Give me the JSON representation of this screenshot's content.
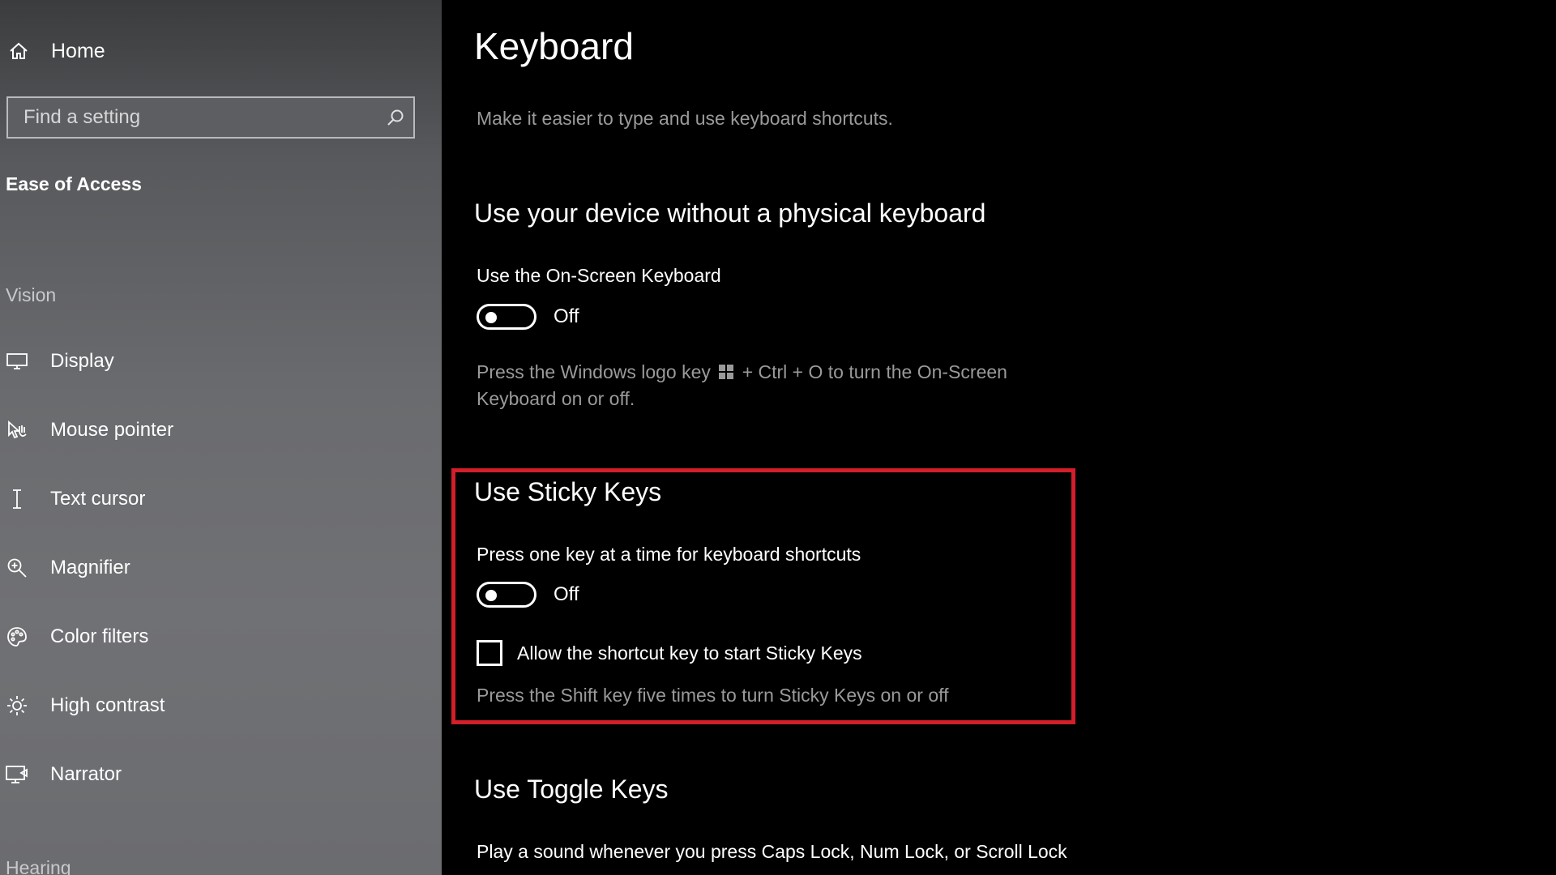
{
  "sidebar": {
    "home_label": "Home",
    "search_placeholder": "Find a setting",
    "category": "Ease of Access",
    "group_vision": "Vision",
    "items": [
      {
        "label": "Display",
        "icon": "display-icon"
      },
      {
        "label": "Mouse pointer",
        "icon": "mouse-pointer-icon"
      },
      {
        "label": "Text cursor",
        "icon": "text-cursor-icon"
      },
      {
        "label": "Magnifier",
        "icon": "magnifier-icon"
      },
      {
        "label": "Color filters",
        "icon": "color-filters-icon"
      },
      {
        "label": "High contrast",
        "icon": "high-contrast-icon"
      },
      {
        "label": "Narrator",
        "icon": "narrator-icon"
      }
    ],
    "group_hearing": "Hearing"
  },
  "main": {
    "title": "Keyboard",
    "description": "Make it easier to type and use keyboard shortcuts.",
    "osk": {
      "section_title": "Use your device without a physical keyboard",
      "setting_label": "Use the On-Screen Keyboard",
      "toggle_state": "Off",
      "toggle_on": false,
      "help_part1": "Press the Windows logo key",
      "help_part2": "+ Ctrl + O to turn the On-Screen",
      "help_line2": "Keyboard on or off."
    },
    "sticky": {
      "section_title": "Use Sticky Keys",
      "setting_label": "Press one key at a time for keyboard shortcuts",
      "toggle_state": "Off",
      "toggle_on": false,
      "checkbox_label": "Allow the shortcut key to start Sticky Keys",
      "checkbox_checked": false,
      "help_text": "Press the Shift key five times to turn Sticky Keys on or off"
    },
    "toggle_keys": {
      "section_title": "Use Toggle Keys",
      "setting_label": "Play a sound whenever you press Caps Lock, Num Lock, or Scroll Lock"
    }
  },
  "colors": {
    "highlight_border": "#d21f2a",
    "main_background": "#000000",
    "secondary_text": "#9a9a9a"
  }
}
